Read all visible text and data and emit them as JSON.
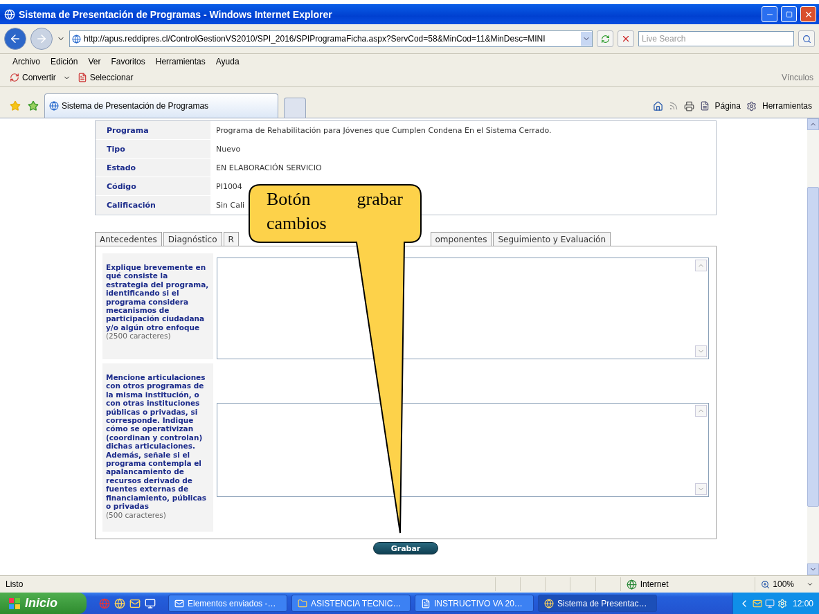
{
  "window": {
    "title": "Sistema de Presentación de Programas - Windows Internet Explorer"
  },
  "address_bar": {
    "url": "http://apus.reddipres.cl/ControlGestionVS2010/SPI_2016/SPIProgramaFicha.aspx?ServCod=58&MinCod=11&MinDesc=MINI"
  },
  "search": {
    "placeholder": "Live Search"
  },
  "menu": [
    "Archivo",
    "Edición",
    "Ver",
    "Favoritos",
    "Herramientas",
    "Ayuda"
  ],
  "pdf_toolbar": {
    "convert": "Convertir",
    "select": "Seleccionar",
    "links": "Vínculos"
  },
  "browser_tab": {
    "title": "Sistema de Presentación de Programas"
  },
  "command_bar": {
    "page": "Página",
    "tools": "Herramientas"
  },
  "info": [
    {
      "label": "Programa",
      "value": "Programa de Rehabilitación para Jóvenes que Cumplen Condena En el Sistema Cerrado."
    },
    {
      "label": "Tipo",
      "value": "Nuevo"
    },
    {
      "label": "Estado",
      "value": "EN ELABORACIÓN SERVICIO"
    },
    {
      "label": "Código",
      "value": "PI1004"
    },
    {
      "label": "Calificación",
      "value": "Sin Cali"
    }
  ],
  "tabs": [
    {
      "label": "Antecedentes",
      "kind": "whole"
    },
    {
      "label": "Diagnóstico",
      "kind": "whole"
    },
    {
      "label": "R",
      "kind": "cut_end"
    },
    {
      "label": "omponentes",
      "kind": "cut_start"
    },
    {
      "label": "Seguimiento y Evaluación",
      "kind": "whole"
    }
  ],
  "questions": [
    {
      "text": "Explique brevemente en qué consiste la estrategia del programa, identificando si el programa considera mecanismos de participación ciudadana y/o algún otro enfoque",
      "limit": "(2500 caracteres)"
    },
    {
      "text": "Mencione articulaciones con otros programas de la misma institución, o con otras instituciones públicas o privadas, si corresponde. Indique cómo se operativizan (coordinan y controlan) dichas articulaciones. Además, señale si el programa contempla el apalancamiento de recursos derivado de fuentes externas de financiamiento, públicas o privadas",
      "limit": "(500 caracteres)"
    }
  ],
  "save_button": "Grabar",
  "callout": {
    "text": "Botón grabar cambios"
  },
  "status_bar": {
    "text": "Listo",
    "zone": "Internet",
    "zoom": "100%"
  },
  "taskbar": {
    "start": "Inicio",
    "tasks": [
      {
        "label": "Elementos enviados -…",
        "kind": "mail",
        "selected": false
      },
      {
        "label": "ASISTENCIA TECNIC…",
        "kind": "folder",
        "selected": false
      },
      {
        "label": "INSTRUCTIVO VA 20…",
        "kind": "doc",
        "selected": false
      },
      {
        "label": "Sistema de Presentac…",
        "kind": "browser",
        "selected": true
      }
    ],
    "clock": "12:00"
  }
}
